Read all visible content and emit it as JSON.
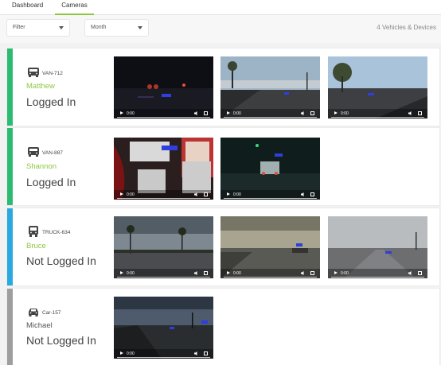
{
  "nav": {
    "tabs": [
      "Dashboard",
      "Cameras"
    ],
    "active": "Cameras",
    "accent": "#8dc63f"
  },
  "filters": {
    "filter_label": "Filter",
    "month_label": "Month",
    "count_text": "4 Vehicles & Devices"
  },
  "video_time": "0:00",
  "vehicles": [
    {
      "id": "VAN-712",
      "driver": "Matthew",
      "status": "Logged In",
      "icon": "van-icon",
      "stripe_color": "#2dbb73",
      "driver_color": "#8dc63f"
    },
    {
      "id": "VAN-887",
      "driver": "Shannon",
      "status": "Logged In",
      "icon": "van-icon",
      "stripe_color": "#2dbb73",
      "driver_color": "#8dc63f"
    },
    {
      "id": "TRUCK-634",
      "driver": "Bruce",
      "status": "Not Logged In",
      "icon": "truck-icon",
      "stripe_color": "#2aa9e0",
      "driver_color": "#8dc63f"
    },
    {
      "id": "Car-157",
      "driver": "Michael",
      "status": "Not Logged In",
      "icon": "car-icon",
      "stripe_color": "#9e9e9e",
      "driver_color": "#555555"
    }
  ]
}
